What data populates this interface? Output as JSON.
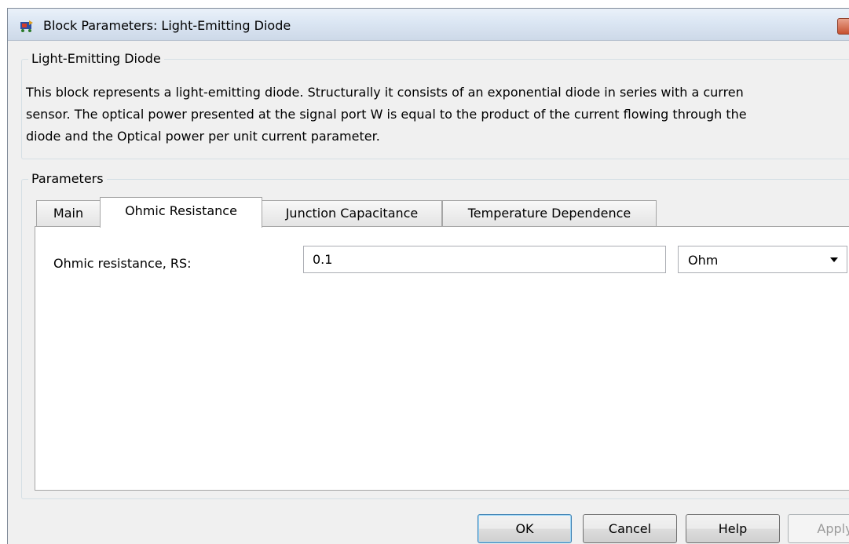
{
  "window": {
    "title": "Block Parameters: Light-Emitting Diode"
  },
  "block": {
    "group_title": "Light-Emitting Diode",
    "description_lines": [
      "This block represents a light-emitting diode. Structurally it consists of an exponential diode in series with a curren",
      "sensor. The optical power presented at the signal port W is equal to the product of the current flowing through the",
      "diode and the Optical power per unit current parameter."
    ]
  },
  "parameters": {
    "group_title": "Parameters",
    "tabs": [
      {
        "label": "Main",
        "active": false
      },
      {
        "label": "Ohmic Resistance",
        "active": true
      },
      {
        "label": "Junction Capacitance",
        "active": false
      },
      {
        "label": "Temperature Dependence",
        "active": false
      }
    ],
    "ohmic_resistance": {
      "label": "Ohmic resistance, RS:",
      "value": "0.1",
      "unit": "Ohm"
    }
  },
  "buttons": {
    "ok": "OK",
    "cancel": "Cancel",
    "help": "Help",
    "apply": "Apply"
  },
  "colors": {
    "title_bar": "#dbe6f3",
    "dialog_background": "#f0f0f0",
    "default_button_border": "#3c7fb1",
    "close_button": "#c75130"
  },
  "icons": {
    "app_icon": "simulink-block-icon",
    "dropdown": "chevron-down-icon"
  }
}
